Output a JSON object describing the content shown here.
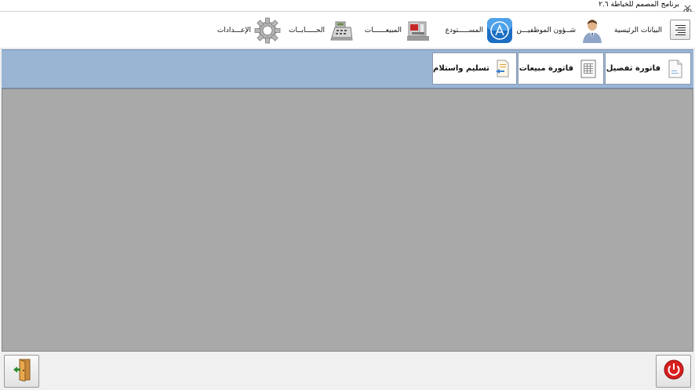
{
  "window": {
    "title": "برنامج المصمم للخياطة ٢.٦",
    "app_icon": "scissors-icon"
  },
  "toolbar": {
    "menu_icon": "menu-lines-icon",
    "items": [
      {
        "label": "البيانات الرئيسية",
        "icon": "list-lines-icon"
      },
      {
        "label": "شــؤون الموظفيـــن",
        "icon": "employee-icon"
      },
      {
        "label": "المســـــتودع",
        "icon": "app-store-icon"
      },
      {
        "label": "المبيعــــــات",
        "icon": "sewing-machine-icon"
      },
      {
        "label": "الحـــــابــات",
        "icon": "cash-register-icon"
      },
      {
        "label": "الإعـــدادات",
        "icon": "gear-icon"
      }
    ]
  },
  "subbar": {
    "buttons": [
      {
        "label": "فاتورة تفصيل",
        "icon": "document-icon"
      },
      {
        "label": "فاتورة مبيعات",
        "icon": "invoice-icon"
      },
      {
        "label": "تسليم واستلام",
        "icon": "exchange-document-icon"
      }
    ]
  },
  "footer": {
    "power_icon": "power-icon",
    "exit_icon": "exit-door-icon"
  },
  "colors": {
    "subbar": "#9ab4d4",
    "content": "#a9a9a9",
    "power": "#d81e1e"
  }
}
